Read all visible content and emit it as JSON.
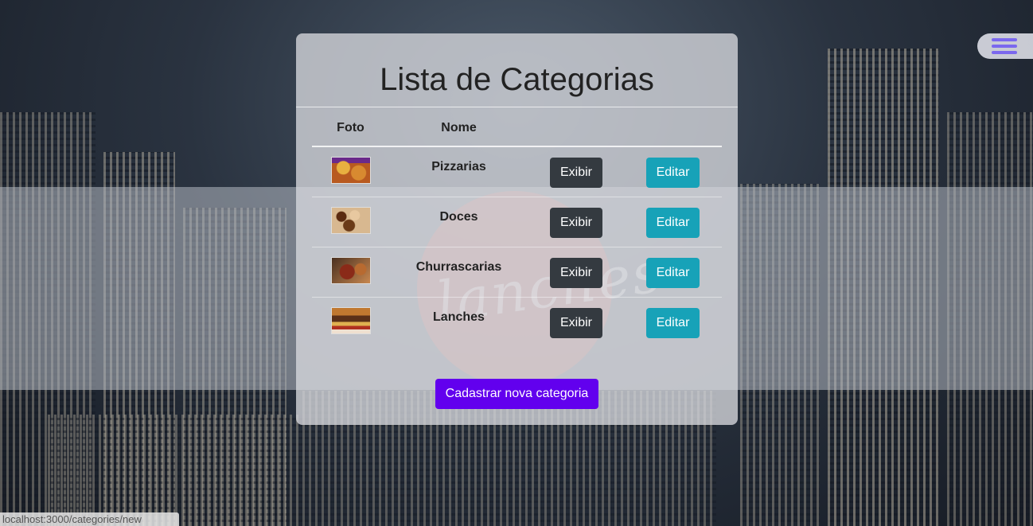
{
  "page": {
    "title": "Lista de Categorias"
  },
  "table": {
    "headers": [
      "Foto",
      "Nome"
    ],
    "rows": [
      {
        "name": "Pizzarias",
        "show_label": "Exibir",
        "edit_label": "Editar",
        "thumb": "pizza-thumbnail"
      },
      {
        "name": "Doces",
        "show_label": "Exibir",
        "edit_label": "Editar",
        "thumb": "sweets-thumbnail"
      },
      {
        "name": "Churrascarias",
        "show_label": "Exibir",
        "edit_label": "Editar",
        "thumb": "barbecue-thumbnail"
      },
      {
        "name": "Lanches",
        "show_label": "Exibir",
        "edit_label": "Editar",
        "thumb": "burger-thumbnail"
      }
    ]
  },
  "actions": {
    "new_category_label": "Cadastrar nova categoria"
  },
  "logo": {
    "text": "lanches"
  },
  "menu": {
    "icon": "hamburger-menu-icon"
  },
  "status_bar": {
    "url": "localhost:3000/categories/new"
  },
  "colors": {
    "show_button": "#343a40",
    "edit_button": "#17a2b8",
    "new_button": "#6200ee",
    "menu_icon": "#7b68ee"
  }
}
